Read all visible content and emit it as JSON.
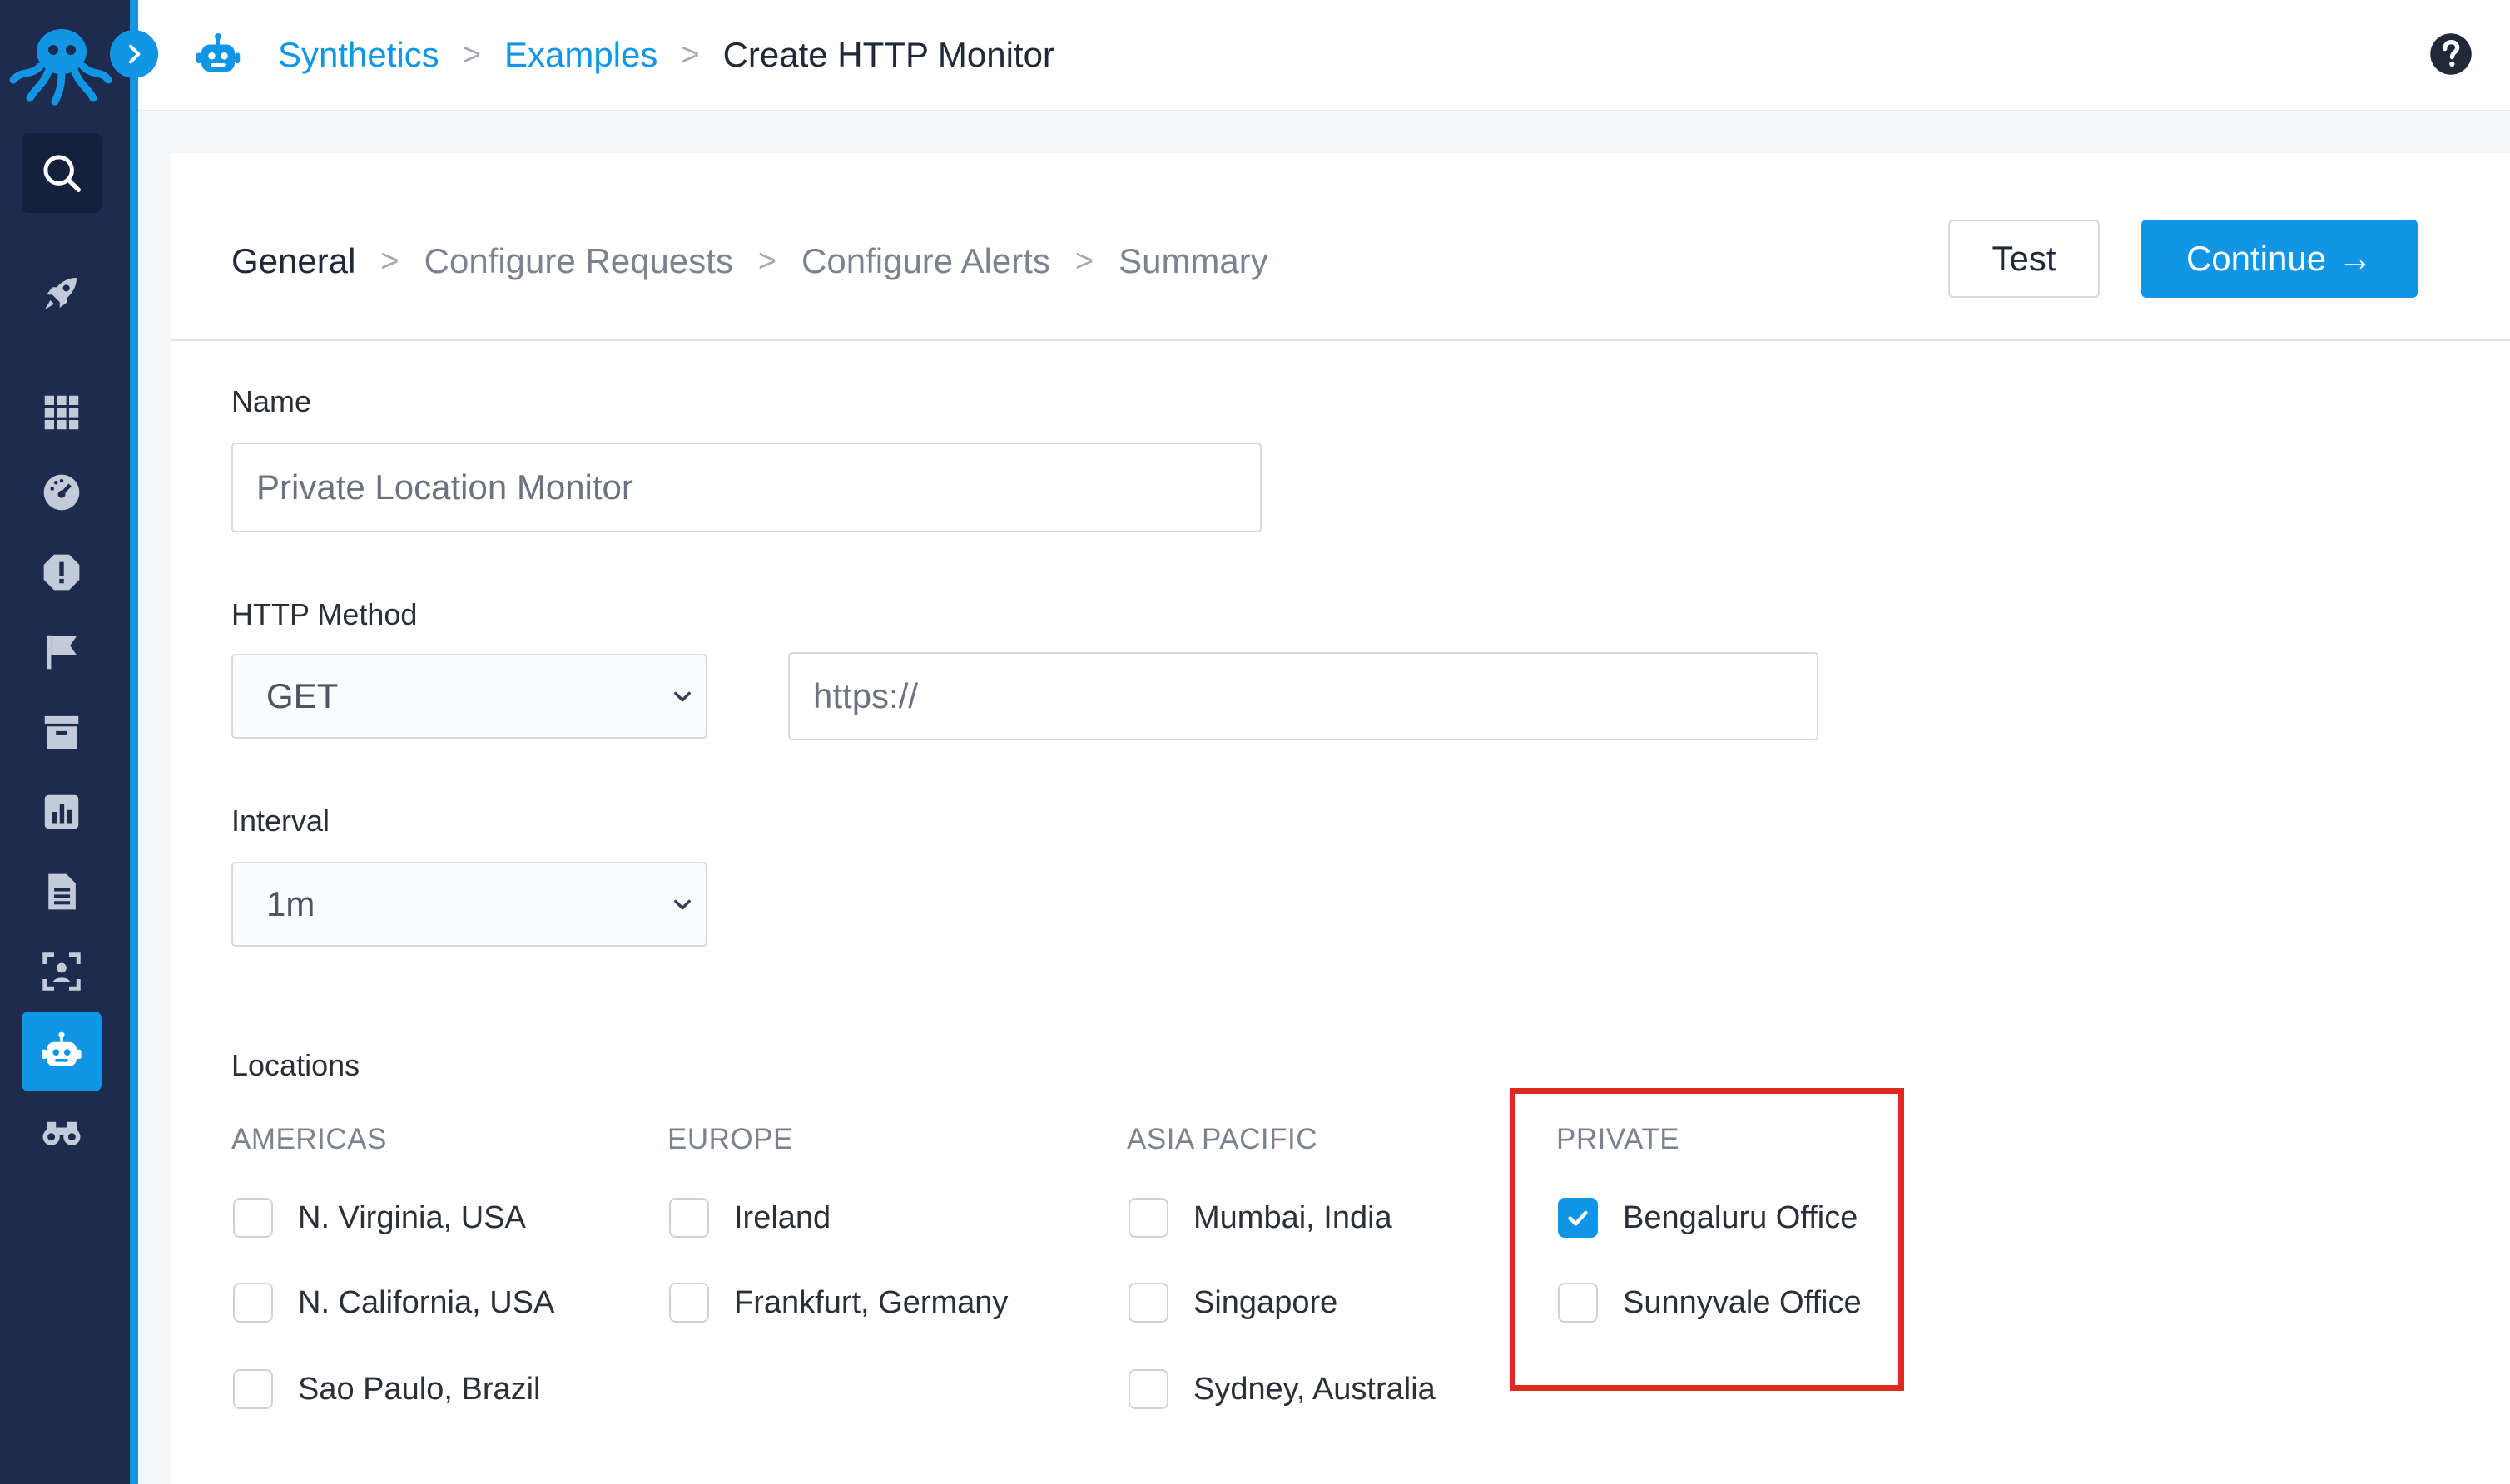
{
  "breadcrumb": {
    "items": [
      {
        "label": "Synthetics"
      },
      {
        "label": "Examples"
      },
      {
        "label": "Create HTTP Monitor"
      }
    ],
    "separator": ">"
  },
  "steps": {
    "items": [
      {
        "label": "General",
        "active": true
      },
      {
        "label": "Configure Requests"
      },
      {
        "label": "Configure Alerts"
      },
      {
        "label": "Summary"
      }
    ],
    "separator": ">"
  },
  "buttons": {
    "test_label": "Test",
    "continue_label": "Continue",
    "continue_arrow": "→"
  },
  "form": {
    "name_label": "Name",
    "name_value": "Private Location Monitor",
    "method_label": "HTTP Method",
    "method_value": "GET",
    "url_value": "https://",
    "interval_label": "Interval",
    "interval_value": "1m",
    "locations_label": "Locations"
  },
  "locations": {
    "groups": [
      {
        "header": "AMERICAS",
        "items": [
          {
            "label": "N. Virginia, USA",
            "checked": false
          },
          {
            "label": "N. California, USA",
            "checked": false
          },
          {
            "label": "Sao Paulo, Brazil",
            "checked": false
          }
        ]
      },
      {
        "header": "EUROPE",
        "items": [
          {
            "label": "Ireland",
            "checked": false
          },
          {
            "label": "Frankfurt, Germany",
            "checked": false
          }
        ]
      },
      {
        "header": "ASIA PACIFIC",
        "items": [
          {
            "label": "Mumbai, India",
            "checked": false
          },
          {
            "label": "Singapore",
            "checked": false
          },
          {
            "label": "Sydney, Australia",
            "checked": false
          }
        ]
      },
      {
        "header": "PRIVATE",
        "items": [
          {
            "label": "Bengaluru Office",
            "checked": true
          },
          {
            "label": "Sunnyvale Office",
            "checked": false
          }
        ]
      }
    ]
  },
  "sidebar": {
    "icons": [
      "octopus-logo-icon",
      "search-icon",
      "rocket-icon",
      "apps-grid-icon",
      "dashboard-gauge-icon",
      "alert-icon",
      "flag-icon",
      "archive-icon",
      "chart-icon",
      "document-icon",
      "user-scan-icon",
      "robot-icon",
      "binoculars-icon"
    ],
    "active": "robot-icon"
  },
  "colors": {
    "sidebar_bg": "#1d2b4f",
    "accent": "#1196e6",
    "highlight_border": "#dc2a1c"
  }
}
